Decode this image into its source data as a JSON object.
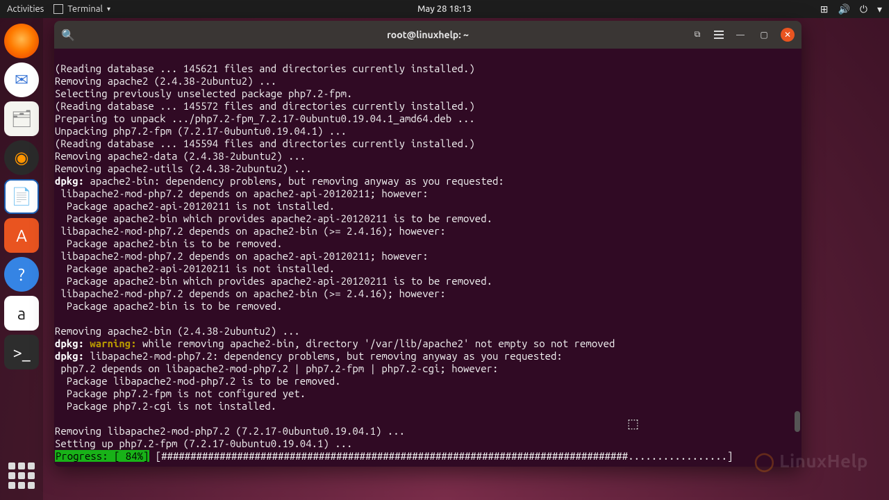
{
  "topbar": {
    "activities": "Activities",
    "app_name": "Terminal",
    "datetime": "May 28  18:13"
  },
  "dock": {
    "items": [
      {
        "name": "firefox-icon",
        "glyph": ""
      },
      {
        "name": "thunderbird-icon",
        "glyph": "✉"
      },
      {
        "name": "files-icon",
        "glyph": "🗂"
      },
      {
        "name": "rhythmbox-icon",
        "glyph": "◉"
      },
      {
        "name": "writer-icon",
        "glyph": "📄"
      },
      {
        "name": "software-icon",
        "glyph": "A"
      },
      {
        "name": "help-icon",
        "glyph": "?"
      },
      {
        "name": "amazon-icon",
        "glyph": "a"
      },
      {
        "name": "terminal-icon",
        "glyph": ">_"
      }
    ]
  },
  "window": {
    "title": "root@linuxhelp: ~"
  },
  "terminal": {
    "l1": "(Reading database ... 145621 files and directories currently installed.)",
    "l2": "Removing apache2 (2.4.38-2ubuntu2) ...",
    "l3": "Selecting previously unselected package php7.2-fpm.",
    "l4": "(Reading database ... 145572 files and directories currently installed.)",
    "l5": "Preparing to unpack .../php7.2-fpm_7.2.17-0ubuntu0.19.04.1_amd64.deb ...",
    "l6": "Unpacking php7.2-fpm (7.2.17-0ubuntu0.19.04.1) ...",
    "l7": "(Reading database ... 145594 files and directories currently installed.)",
    "l8": "Removing apache2-data (2.4.38-2ubuntu2) ...",
    "l9": "Removing apache2-utils (2.4.38-2ubuntu2) ...",
    "l10a": "dpkg:",
    "l10b": " apache2-bin: dependency problems, but removing anyway as you requested:",
    "l11": " libapache2-mod-php7.2 depends on apache2-api-20120211; however:",
    "l12": "  Package apache2-api-20120211 is not installed.",
    "l13": "  Package apache2-bin which provides apache2-api-20120211 is to be removed.",
    "l14": " libapache2-mod-php7.2 depends on apache2-bin (>= 2.4.16); however:",
    "l15": "  Package apache2-bin is to be removed.",
    "l16": " libapache2-mod-php7.2 depends on apache2-api-20120211; however:",
    "l17": "  Package apache2-api-20120211 is not installed.",
    "l18": "  Package apache2-bin which provides apache2-api-20120211 is to be removed.",
    "l19": " libapache2-mod-php7.2 depends on apache2-bin (>= 2.4.16); however:",
    "l20": "  Package apache2-bin is to be removed.",
    "l21": "",
    "l22": "Removing apache2-bin (2.4.38-2ubuntu2) ...",
    "l23a": "dpkg: ",
    "l23b": "warning:",
    "l23c": " while removing apache2-bin, directory '/var/lib/apache2' not empty so not removed",
    "l24a": "dpkg:",
    "l24b": " libapache2-mod-php7.2: dependency problems, but removing anyway as you requested:",
    "l25": " php7.2 depends on libapache2-mod-php7.2 | php7.2-fpm | php7.2-cgi; however:",
    "l26": "  Package libapache2-mod-php7.2 is to be removed.",
    "l27": "  Package php7.2-fpm is not configured yet.",
    "l28": "  Package php7.2-cgi is not installed.",
    "l29": "",
    "l30": "Removing libapache2-mod-php7.2 (7.2.17-0ubuntu0.19.04.1) ...",
    "l31": "Setting up php7.2-fpm (7.2.17-0ubuntu0.19.04.1) ...",
    "progress_label": "Progress: [ 84%]",
    "progress_bar": " [################################################################################.................] "
  },
  "watermark": "LinuxHelp"
}
